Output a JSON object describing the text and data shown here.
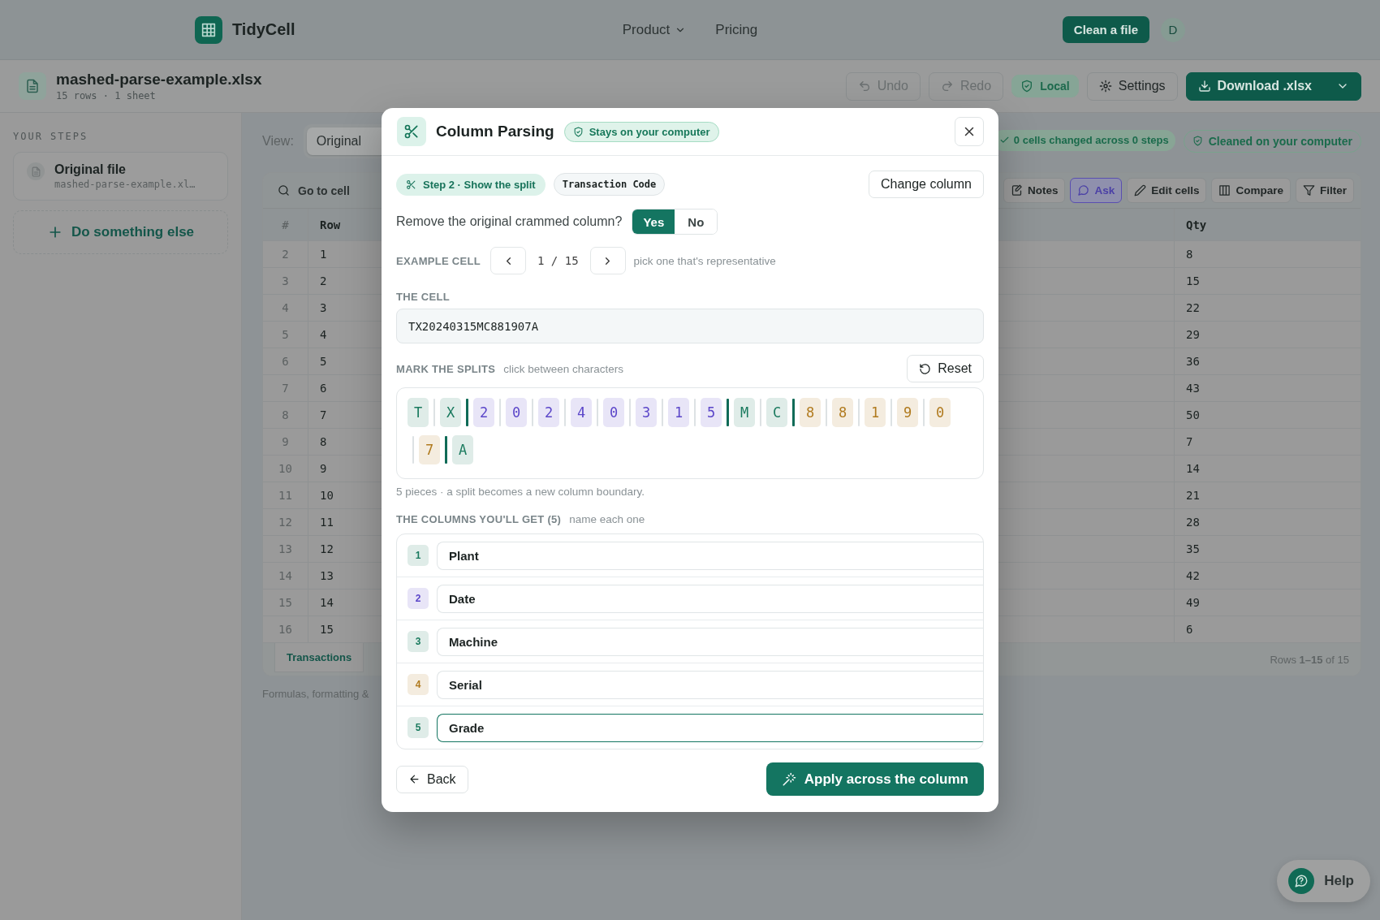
{
  "nav": {
    "brand": "TidyCell",
    "links": [
      {
        "label": "Product",
        "dropdown": true
      },
      {
        "label": "Pricing",
        "dropdown": false
      }
    ],
    "cta": "Clean a file",
    "avatar": "D"
  },
  "file": {
    "name": "mashed-parse-example.xlsx",
    "meta": "15 rows · 1 sheet",
    "actions": [
      {
        "label": "Undo",
        "kind": "undo",
        "disabled": true
      },
      {
        "label": "Redo",
        "kind": "redo",
        "disabled": true
      },
      {
        "label": "Local",
        "kind": "local",
        "disabled": false
      },
      {
        "label": "Settings",
        "kind": "settings",
        "disabled": false
      },
      {
        "label": "Download .xlsx",
        "kind": "download",
        "disabled": false
      }
    ]
  },
  "sidebar": {
    "heading": "YOUR STEPS",
    "steps": [
      {
        "title": "Original file",
        "file": "mashed-parse-example.xl…"
      }
    ],
    "add": "Do something else"
  },
  "view": {
    "label": "View:",
    "options": [
      {
        "label": "Original",
        "selected": true
      }
    ]
  },
  "status": {
    "changes": "0 cells changed across 0 steps",
    "privacy": "Cleaned on your computer"
  },
  "table": {
    "search": {
      "placeholder": "Go to cell"
    },
    "tools": [
      {
        "label": "Notes",
        "kind": "notes",
        "selected": false
      },
      {
        "label": "Ask",
        "kind": "ask",
        "selected": true
      },
      {
        "label": "Edit cells",
        "kind": "edit",
        "selected": false
      },
      {
        "label": "Compare",
        "kind": "compare",
        "selected": false
      },
      {
        "label": "Filter",
        "kind": "filter",
        "selected": false
      }
    ],
    "columns": [
      "#",
      "Row",
      "Qty"
    ],
    "rows": [
      {
        "n": "2",
        "row": "1",
        "qty": "8"
      },
      {
        "n": "3",
        "row": "2",
        "qty": "15"
      },
      {
        "n": "4",
        "row": "3",
        "qty": "22"
      },
      {
        "n": "5",
        "row": "4",
        "qty": "29"
      },
      {
        "n": "6",
        "row": "5",
        "qty": "36"
      },
      {
        "n": "7",
        "row": "6",
        "qty": "43"
      },
      {
        "n": "8",
        "row": "7",
        "qty": "50"
      },
      {
        "n": "9",
        "row": "8",
        "qty": "7"
      },
      {
        "n": "10",
        "row": "9",
        "qty": "14"
      },
      {
        "n": "11",
        "row": "10",
        "qty": "21"
      },
      {
        "n": "12",
        "row": "11",
        "qty": "28"
      },
      {
        "n": "13",
        "row": "12",
        "qty": "35"
      },
      {
        "n": "14",
        "row": "13",
        "qty": "42"
      },
      {
        "n": "15",
        "row": "14",
        "qty": "49"
      },
      {
        "n": "16",
        "row": "15",
        "qty": "6"
      }
    ],
    "sheet_tabs": [
      {
        "label": "Transactions",
        "selected": true
      }
    ],
    "range": "Rows **1–15** of 15"
  },
  "footnote": "Formulas, formatting &",
  "modal": {
    "title": "Column Parsing",
    "badge": "Stays on your computer",
    "step": "Step 2 · Show the split",
    "column": "Transaction Code",
    "change_button": "Change column",
    "remove_question": "Remove the original crammed column?",
    "remove_options": [
      {
        "label": "Yes",
        "selected": true
      },
      {
        "label": "No",
        "selected": false
      }
    ],
    "example_label": "EXAMPLE CELL",
    "example_position": "1 / 15",
    "example_hint": "pick one that's representative",
    "cell_label": "THE CELL",
    "cell_value": "TX20240315MC881907A",
    "splits_label": "MARK THE SPLITS",
    "splits_hint": "click between characters",
    "reset_button": "Reset",
    "characters": [
      {
        "char": "T",
        "color": "#1a7a5e",
        "split_before": false
      },
      {
        "char": "X",
        "color": "#1a7a5e",
        "split_before": false
      },
      {
        "char": "2",
        "color": "#5b46c9",
        "split_before": true
      },
      {
        "char": "0",
        "color": "#5b46c9",
        "split_before": false
      },
      {
        "char": "2",
        "color": "#5b46c9",
        "split_before": false
      },
      {
        "char": "4",
        "color": "#5b46c9",
        "split_before": false
      },
      {
        "char": "0",
        "color": "#5b46c9",
        "split_before": false
      },
      {
        "char": "3",
        "color": "#5b46c9",
        "split_before": false
      },
      {
        "char": "1",
        "color": "#5b46c9",
        "split_before": false
      },
      {
        "char": "5",
        "color": "#5b46c9",
        "split_before": false
      },
      {
        "char": "M",
        "color": "#1a7a5e",
        "split_before": true
      },
      {
        "char": "C",
        "color": "#1a7a5e",
        "split_before": false
      },
      {
        "char": "8",
        "color": "#b07a1e",
        "split_before": true
      },
      {
        "char": "8",
        "color": "#b07a1e",
        "split_before": false
      },
      {
        "char": "1",
        "color": "#b07a1e",
        "split_before": false
      },
      {
        "char": "9",
        "color": "#b07a1e",
        "split_before": false
      },
      {
        "char": "0",
        "color": "#b07a1e",
        "split_before": false
      },
      {
        "char": "7",
        "color": "#b07a1e",
        "split_before": false
      },
      {
        "char": "A",
        "color": "#1a7a5e",
        "split_before": true
      }
    ],
    "pieces_note": "5 pieces · a split becomes a new column boundary.",
    "columns_label": "THE COLUMNS YOU'LL GET (5)",
    "columns_hint": "name each one",
    "columns": [
      {
        "number": "1",
        "name": "Plant",
        "color": "#1a7a5e",
        "focused": false
      },
      {
        "number": "2",
        "name": "Date",
        "color": "#5b46c9",
        "focused": false
      },
      {
        "number": "3",
        "name": "Machine",
        "color": "#1a7a5e",
        "focused": false
      },
      {
        "number": "4",
        "name": "Serial",
        "color": "#b07a1e",
        "focused": false
      },
      {
        "number": "5",
        "name": "Grade",
        "color": "#1a7a5e",
        "focused": true
      }
    ],
    "back_button": "Back",
    "apply_button": "Apply across the column"
  },
  "help": "Help"
}
